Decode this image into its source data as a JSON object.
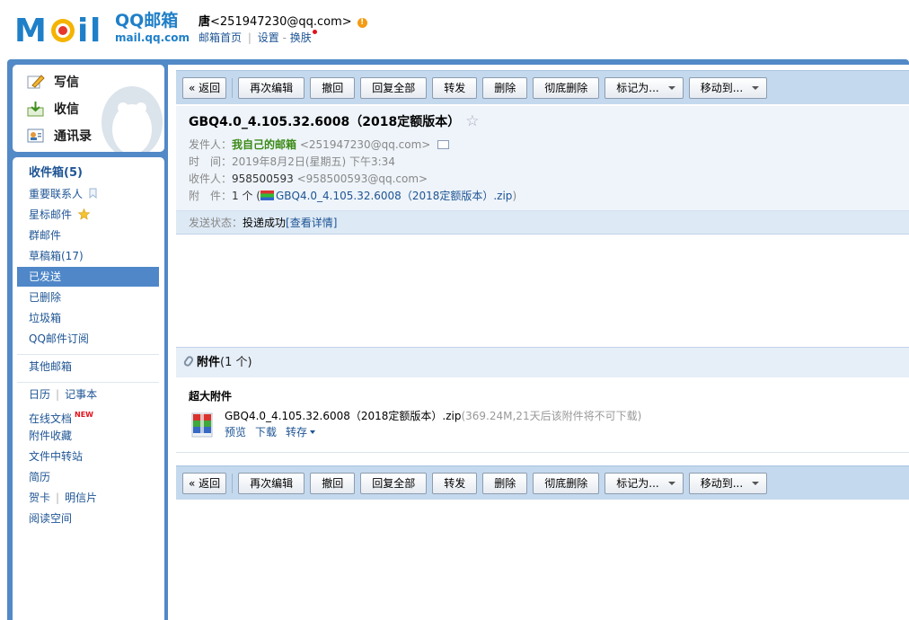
{
  "header": {
    "logo_cn": "QQ邮箱",
    "logo_url": "mail.qq.com",
    "user_name": "唐",
    "user_email": "<251947230@qq.com>",
    "notify_badge": "!",
    "links": {
      "home": "邮箱首页",
      "settings": "设置",
      "dash": "-",
      "skin": "换肤"
    }
  },
  "sidebar": {
    "quick": {
      "compose": "写信",
      "inbox": "收信",
      "contacts": "通讯录"
    },
    "folders": {
      "inbox": "收件箱(5)",
      "important": "重要联系人",
      "starred": "星标邮件",
      "group": "群邮件",
      "drafts": "草稿箱(17)",
      "sent": "已发送",
      "deleted": "已删除",
      "spam": "垃圾箱",
      "subscription": "QQ邮件订阅"
    },
    "other_mailboxes": "其他邮箱",
    "apps": {
      "calendar": "日历",
      "notes": "记事本",
      "docs": "在线文档",
      "docs_badge": "NEW",
      "attachments": "附件收藏",
      "transfer": "文件中转站",
      "resume": "简历",
      "cards": "贺卡",
      "postcards": "明信片",
      "reading": "阅读空间"
    }
  },
  "toolbar": {
    "back": "« 返回",
    "reedit": "再次编辑",
    "recall": "撤回",
    "reply_all": "回复全部",
    "forward": "转发",
    "delete": "删除",
    "delete_permanent": "彻底删除",
    "mark_as": "标记为...",
    "move_to": "移动到..."
  },
  "mail": {
    "subject": "GBQ4.0_4.105.32.6008（2018定额版本）",
    "from_label": "发件人：",
    "from_name": "我自己的邮箱",
    "from_addr": "<251947230@qq.com>",
    "time_label": "时　间：",
    "time_value": "2019年8月2日(星期五) 下午3:34",
    "to_label": "收件人：",
    "to_name": "958500593",
    "to_addr": "<958500593@qq.com>",
    "att_label": "附　件：",
    "att_count": "1 个 (",
    "att_name": "GBQ4.0_4.105.32.6008（2018定额版本）.zip",
    "att_close": ")",
    "status_label": "发送状态：",
    "status_value": "投递成功",
    "status_detail": "[查看详情]"
  },
  "attachments": {
    "title": "附件",
    "count": "(1 个)",
    "section_label": "超大附件",
    "file_name": "GBQ4.0_4.105.32.6008（2018定额版本）.zip",
    "file_info": "(369.24M,21天后该附件将不可下载)",
    "preview": "预览",
    "download": "下载",
    "save": "转存"
  }
}
